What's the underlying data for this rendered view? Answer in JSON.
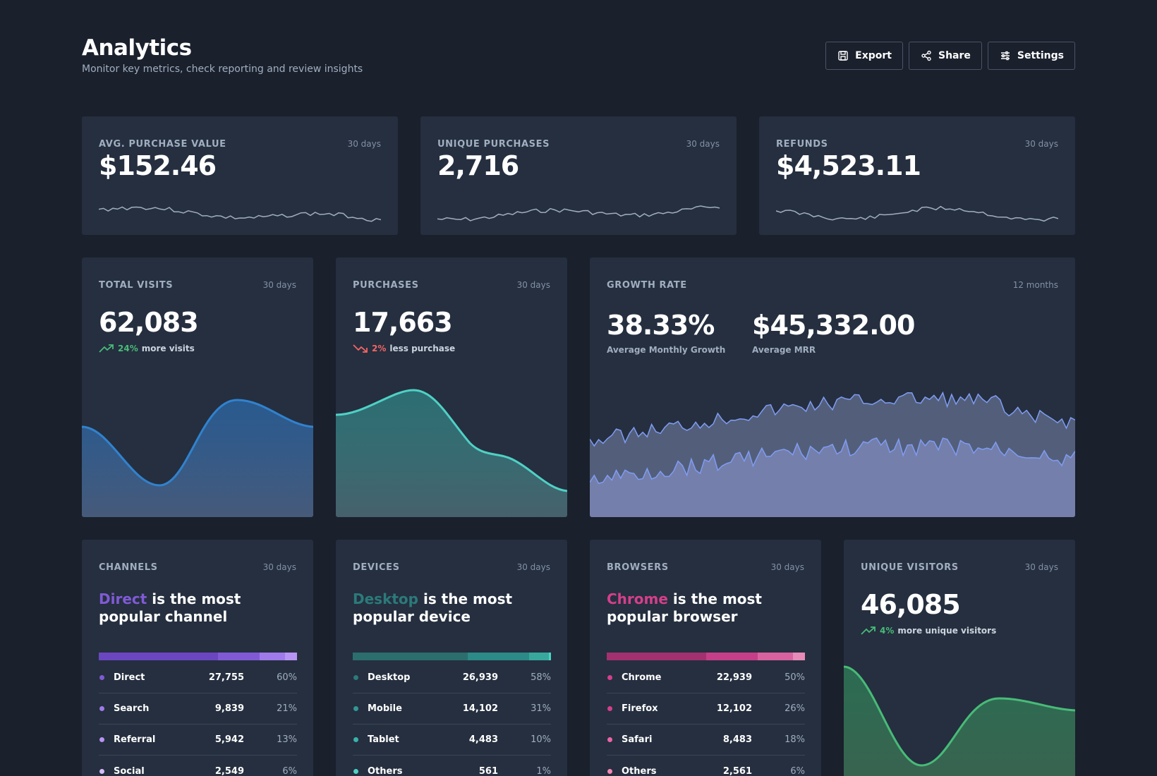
{
  "header": {
    "title": "Analytics",
    "subtitle": "Monitor key metrics, check reporting and review insights",
    "buttons": {
      "export": "Export",
      "share": "Share",
      "settings": "Settings"
    }
  },
  "colors": {
    "background": "#1a202c",
    "card": "#252f3f",
    "blue": "#3182ce",
    "teal": "#4fd1c5",
    "indigo": "#7f9cf5",
    "purple": "#805ad5",
    "pink": "#d53f8c",
    "green": "#48bb78",
    "red": "#f56565"
  },
  "top_cards": [
    {
      "label": "AVG. PURCHASE VALUE",
      "period": "30 days",
      "value": "$152.46"
    },
    {
      "label": "UNIQUE PURCHASES",
      "period": "30 days",
      "value": "2,716"
    },
    {
      "label": "REFUNDS",
      "period": "30 days",
      "value": "$4,523.11"
    }
  ],
  "visits": {
    "label": "TOTAL VISITS",
    "period": "30 days",
    "value": "62,083",
    "trend_pct": "24%",
    "trend_text": "more visits"
  },
  "purchases": {
    "label": "PURCHASES",
    "period": "30 days",
    "value": "17,663",
    "trend_pct": "2%",
    "trend_text": "less purchase"
  },
  "growth": {
    "label": "GROWTH RATE",
    "period": "12 months",
    "rate": "38.33%",
    "rate_label": "Average Monthly Growth",
    "mrr": "$45,332.00",
    "mrr_label": "Average MRR"
  },
  "channels": {
    "label": "CHANNELS",
    "period": "30 days",
    "highlight": "Direct",
    "headline_rest": " is the most popular channel",
    "rows": [
      {
        "name": "Direct",
        "count": "27,755",
        "pct": "60%"
      },
      {
        "name": "Search",
        "count": "9,839",
        "pct": "21%"
      },
      {
        "name": "Referral",
        "count": "5,942",
        "pct": "13%"
      },
      {
        "name": "Social",
        "count": "2,549",
        "pct": "6%"
      }
    ]
  },
  "devices": {
    "label": "DEVICES",
    "period": "30 days",
    "highlight": "Desktop",
    "headline_rest": " is the most popular device",
    "rows": [
      {
        "name": "Desktop",
        "count": "26,939",
        "pct": "58%"
      },
      {
        "name": "Mobile",
        "count": "14,102",
        "pct": "31%"
      },
      {
        "name": "Tablet",
        "count": "4,483",
        "pct": "10%"
      },
      {
        "name": "Others",
        "count": "561",
        "pct": "1%"
      }
    ]
  },
  "browsers": {
    "label": "BROWSERS",
    "period": "30 days",
    "highlight": "Chrome",
    "headline_rest": " is the most popular browser",
    "rows": [
      {
        "name": "Chrome",
        "count": "22,939",
        "pct": "50%"
      },
      {
        "name": "Firefox",
        "count": "12,102",
        "pct": "26%"
      },
      {
        "name": "Safari",
        "count": "8,483",
        "pct": "18%"
      },
      {
        "name": "Others",
        "count": "2,561",
        "pct": "6%"
      }
    ]
  },
  "unique_visitors": {
    "label": "UNIQUE VISITORS",
    "period": "30 days",
    "value": "46,085",
    "trend_pct": "4%",
    "trend_text": "more unique visitors"
  }
}
